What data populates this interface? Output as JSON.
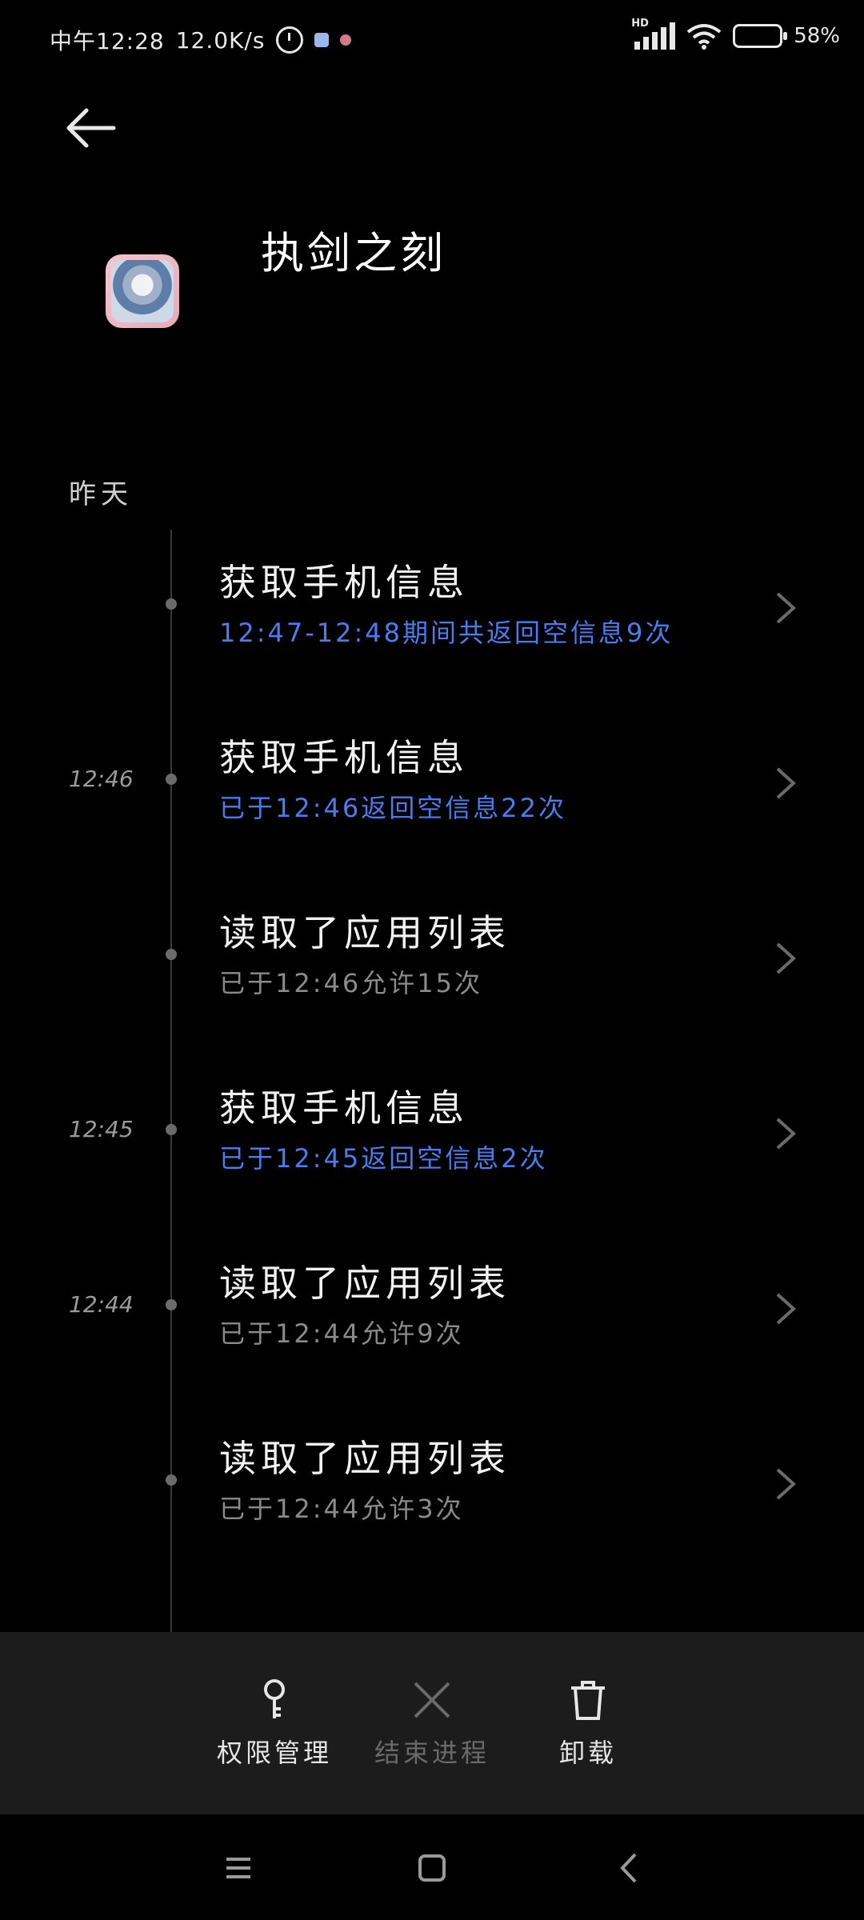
{
  "status_bar": {
    "time": "中午12:28",
    "net_speed": "12.0K/s",
    "network_type": "HD",
    "battery": "58%",
    "battery_level": 0.58,
    "icons": [
      "alarm-icon",
      "notification-icon",
      "notification-icon-2",
      "signal-icon",
      "wifi-icon",
      "battery-icon"
    ]
  },
  "header": {
    "app_name": "执剑之刻"
  },
  "section": {
    "label": "昨天"
  },
  "timeline": {
    "items": [
      {
        "time": "",
        "title": "获取手机信息",
        "subtitle": "12:47-12:48期间共返回空信息9次",
        "subtitle_color": "blue"
      },
      {
        "time": "12:46",
        "title": "获取手机信息",
        "subtitle": "已于12:46返回空信息22次",
        "subtitle_color": "blue"
      },
      {
        "time": "",
        "title": "读取了应用列表",
        "subtitle": "已于12:46允许15次",
        "subtitle_color": "gray"
      },
      {
        "time": "12:45",
        "title": "获取手机信息",
        "subtitle": "已于12:45返回空信息2次",
        "subtitle_color": "blue"
      },
      {
        "time": "12:44",
        "title": "读取了应用列表",
        "subtitle": "已于12:44允许9次",
        "subtitle_color": "gray"
      },
      {
        "time": "",
        "title": "读取了应用列表",
        "subtitle": "已于12:44允许3次",
        "subtitle_color": "gray"
      }
    ]
  },
  "actions": {
    "permissions": "权限管理",
    "end_process": "结束进程",
    "uninstall": "卸载"
  },
  "colors": {
    "background": "#000000",
    "accent_blue": "#4a7cf0",
    "muted_gray": "#8a8a8a",
    "action_bar": "#1c1c1c"
  }
}
